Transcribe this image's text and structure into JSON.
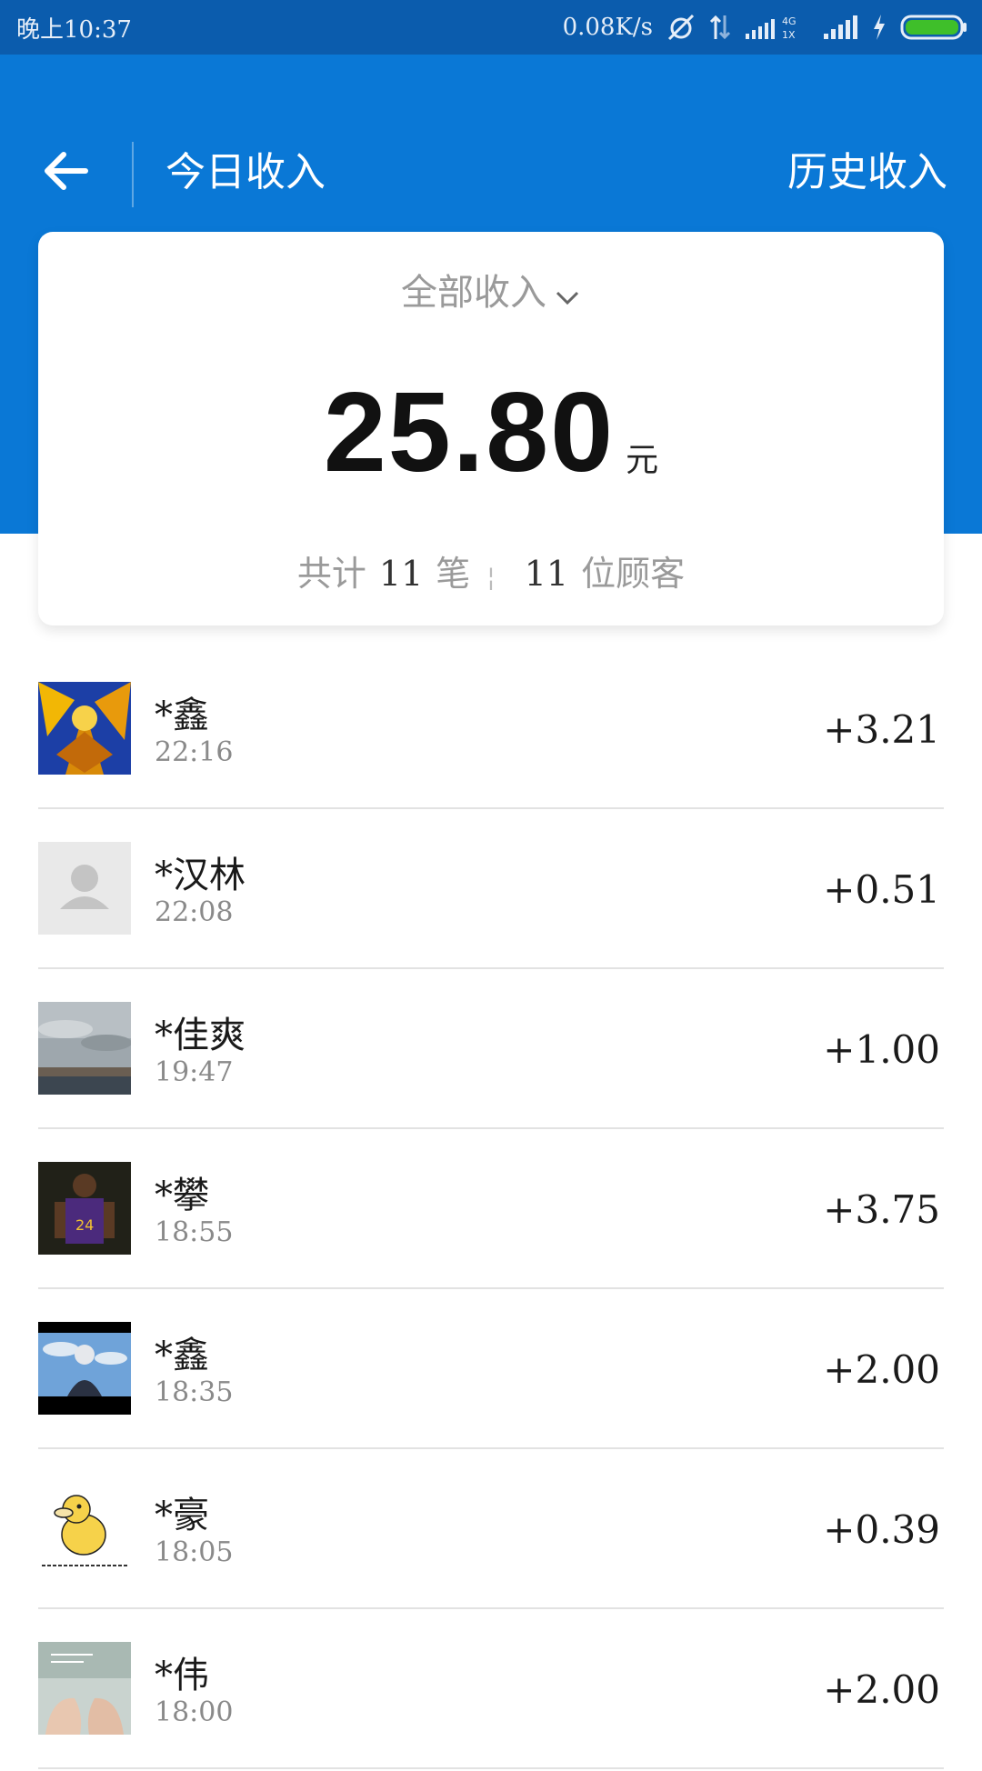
{
  "status_bar": {
    "time": "晚上10:37",
    "net_speed": "0.08K/s"
  },
  "header": {
    "title": "今日收入",
    "history_label": "历史收入"
  },
  "summary": {
    "filter_label": "全部收入",
    "total_amount": "25.80",
    "unit": "元",
    "count_prefix": "共计",
    "count_num": "11",
    "count_unit": "笔",
    "customer_num": "11",
    "customer_unit": "位顾客"
  },
  "transactions": [
    {
      "name": "*鑫",
      "time": "22:16",
      "amount": "+3.21",
      "avatar": "gold-armor-avatar"
    },
    {
      "name": "*汉林",
      "time": "22:08",
      "amount": "+0.51",
      "avatar": "default-user-avatar"
    },
    {
      "name": "*佳爽",
      "time": "19:47",
      "amount": "+1.00",
      "avatar": "landscape-avatar"
    },
    {
      "name": "*攀",
      "time": "18:55",
      "amount": "+3.75",
      "avatar": "basketball-avatar"
    },
    {
      "name": "*鑫",
      "time": "18:35",
      "amount": "+2.00",
      "avatar": "sky-person-avatar"
    },
    {
      "name": "*豪",
      "time": "18:05",
      "amount": "+0.39",
      "avatar": "cartoon-duck-avatar"
    },
    {
      "name": "*伟",
      "time": "18:00",
      "amount": "+2.00",
      "avatar": "hands-avatar"
    }
  ],
  "colors": {
    "status_bar": "#0b5cad",
    "header": "#0a78d6",
    "battery": "#3fbf2a"
  }
}
